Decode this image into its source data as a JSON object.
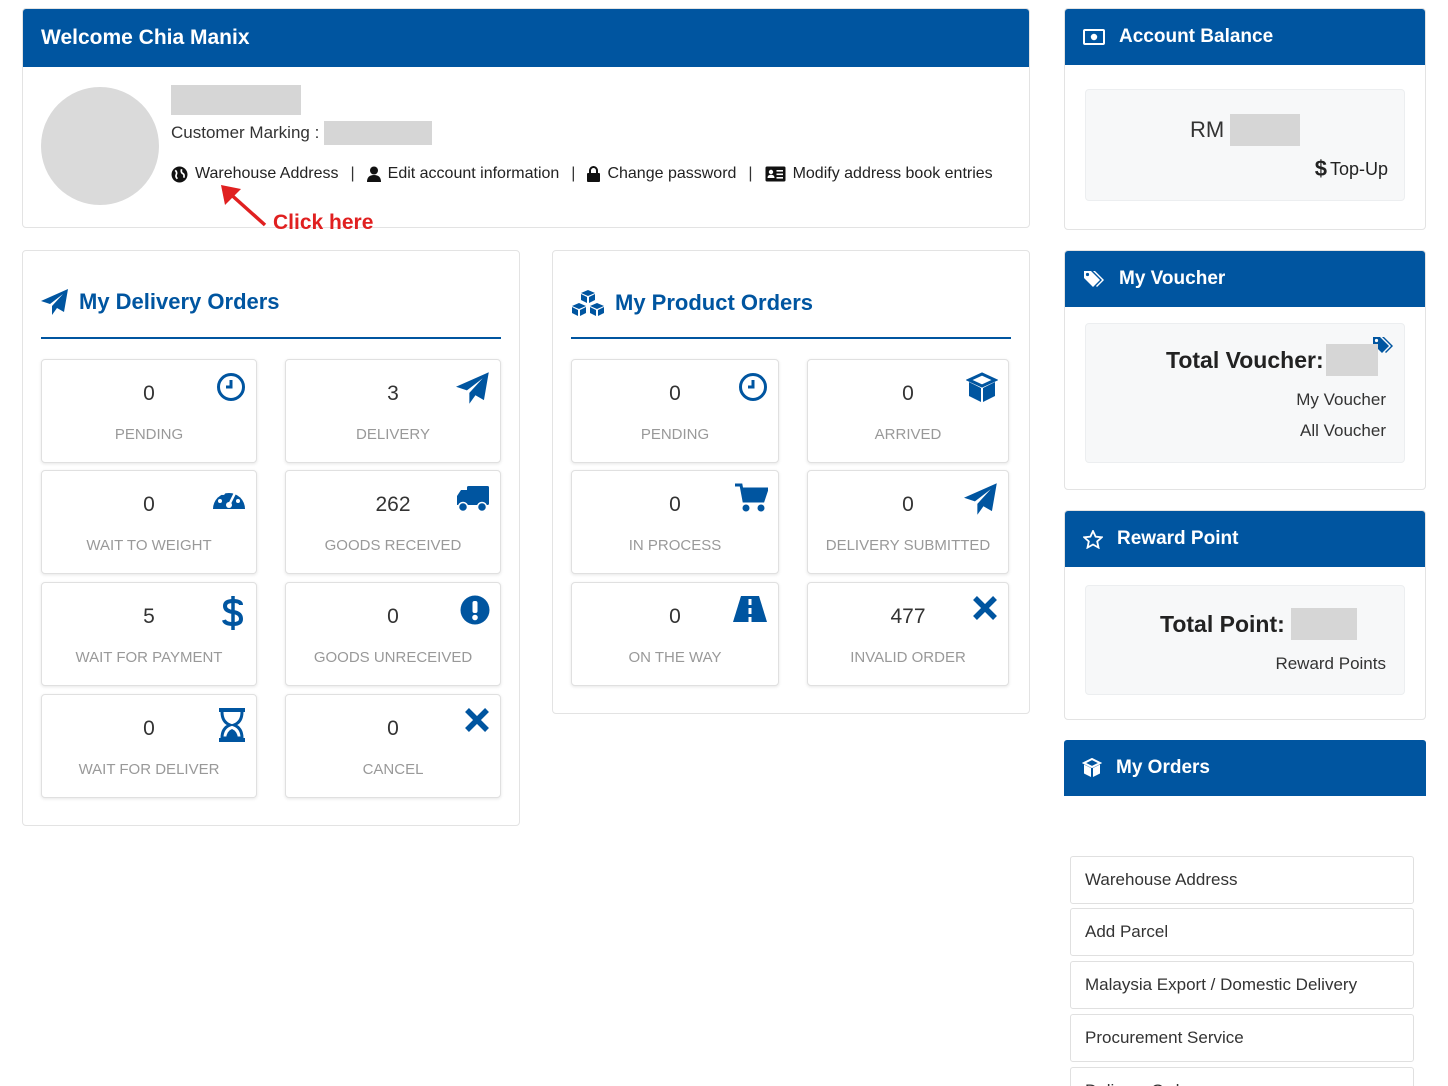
{
  "welcome": {
    "title": "Welcome Chia Manix",
    "customer_marking_label": "Customer Marking :",
    "links": [
      "Warehouse Address",
      "Edit account information",
      "Change password",
      "Modify address book entries"
    ],
    "separator": "|",
    "annotation": "Click here"
  },
  "delivery": {
    "title": "My Delivery Orders",
    "cards": [
      {
        "value": "0",
        "label": "PENDING",
        "icon": "clock-icon"
      },
      {
        "value": "3",
        "label": "DELIVERY",
        "icon": "paper-plane-icon"
      },
      {
        "value": "0",
        "label": "WAIT TO WEIGHT",
        "icon": "gauge-icon"
      },
      {
        "value": "262",
        "label": "GOODS RECEIVED",
        "icon": "truck-icon"
      },
      {
        "value": "5",
        "label": "WAIT FOR PAYMENT",
        "icon": "dollar-icon"
      },
      {
        "value": "0",
        "label": "GOODS UNRECEIVED",
        "icon": "exclamation-icon"
      },
      {
        "value": "0",
        "label": "WAIT FOR DELIVER",
        "icon": "hourglass-icon"
      },
      {
        "value": "0",
        "label": "CANCEL",
        "icon": "x-icon"
      }
    ]
  },
  "product": {
    "title": "My Product Orders",
    "cards": [
      {
        "value": "0",
        "label": "PENDING",
        "icon": "clock-icon"
      },
      {
        "value": "0",
        "label": "ARRIVED",
        "icon": "box-icon"
      },
      {
        "value": "0",
        "label": "IN PROCESS",
        "icon": "cart-icon"
      },
      {
        "value": "0",
        "label": "DELIVERY SUBMITTED",
        "icon": "paper-plane-icon"
      },
      {
        "value": "0",
        "label": "ON THE WAY",
        "icon": "road-icon"
      },
      {
        "value": "477",
        "label": "INVALID ORDER",
        "icon": "x-icon"
      }
    ]
  },
  "balance": {
    "title": "Account Balance",
    "currency": "RM",
    "topup_symbol": "$",
    "topup_label": "Top-Up"
  },
  "voucher": {
    "title": "My Voucher",
    "total_label": "Total Voucher:",
    "my_voucher": "My Voucher",
    "all_voucher": "All Voucher"
  },
  "reward": {
    "title": "Reward Point",
    "total_label": "Total Point:",
    "reward_points": "Reward Points"
  },
  "orders": {
    "title": "My Orders",
    "items": [
      "Warehouse Address",
      "Add Parcel",
      "Malaysia Export / Domestic Delivery",
      "Procurement Service",
      "Delivery Order"
    ]
  },
  "colors": {
    "brand": "#0055a0",
    "annotation": "#e02020"
  }
}
